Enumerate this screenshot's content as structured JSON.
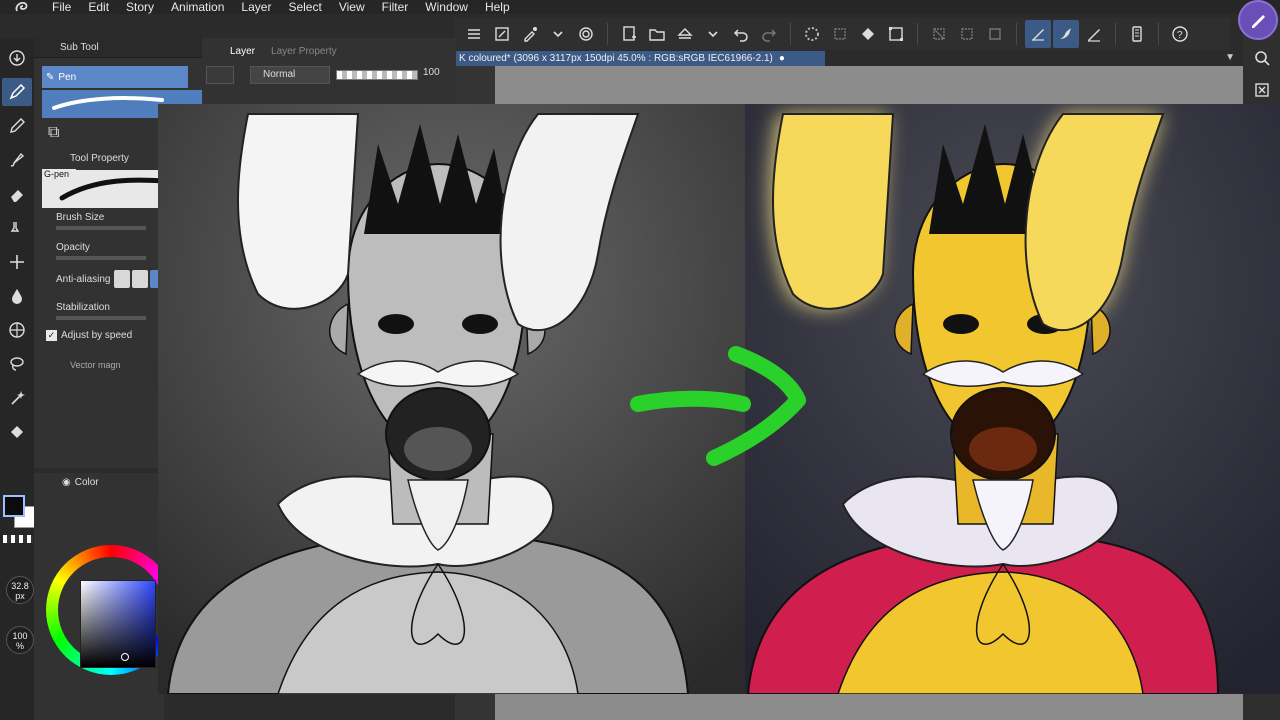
{
  "menu": [
    "File",
    "Edit",
    "Story",
    "Animation",
    "Layer",
    "Select",
    "View",
    "Filter",
    "Window",
    "Help"
  ],
  "canvas": {
    "tab_title": "K coloured* (3096 x 3117px 150dpi 45.0% : RGB:sRGB IEC61966-2.1)"
  },
  "subtool": {
    "header": "Sub Tool",
    "selected_tool": "Pen",
    "property_header": "Tool Property",
    "brush_name": "G-pen",
    "brush_size_label": "Brush Size",
    "brush_size_value": "32",
    "opacity_label": "Opacity",
    "opacity_value": "1",
    "antialias_label": "Anti-aliasing",
    "stabilization_label": "Stabilization",
    "stabilization_value": "1",
    "adjust_label": "Adjust by speed",
    "vector_label": "Vector magn"
  },
  "layer": {
    "tab_layer": "Layer",
    "tab_property": "Layer Property",
    "blend_mode": "Normal",
    "opacity": "100"
  },
  "color_panel": {
    "tab": "Color"
  },
  "badges": {
    "size": "32.8",
    "size_unit": "px",
    "opacity": "100",
    "opacity_unit": "%"
  },
  "colors": {
    "accent": "#3b5a86",
    "selection": "#5b87c7",
    "arrow": "#2ad12a",
    "cape": "#d01e4e",
    "skin": "#f2c62e",
    "glow": "#f9e58a"
  },
  "icons": [
    "undo-icon",
    "redo-icon",
    "menu-icon",
    "search-icon",
    "pen-icon",
    "eraser-icon",
    "fill-icon",
    "lasso-icon"
  ]
}
